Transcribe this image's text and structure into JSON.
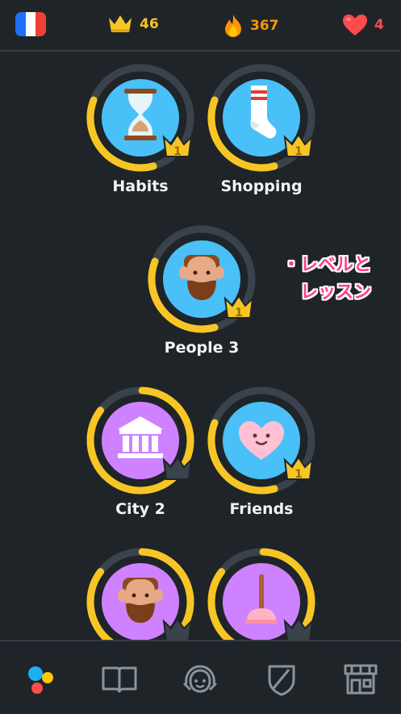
{
  "topbar": {
    "language_flag": "france-flag",
    "flag_colors": [
      "#1e6ff7",
      "#ffffff",
      "#ef4136"
    ],
    "crowns": "46",
    "streak": "367",
    "hearts": "4"
  },
  "skills": [
    {
      "name": "Habits",
      "icon": "hourglass-icon",
      "crown_level": "1",
      "progress": 0.35,
      "color": "#49c0f8"
    },
    {
      "name": "Shopping",
      "icon": "sock-icon",
      "crown_level": "1",
      "progress": 0.35,
      "color": "#49c0f8"
    },
    {
      "name": "People 3",
      "icon": "person-bearded-icon",
      "crown_level": "1",
      "progress": 0.35,
      "color": "#49c0f8"
    },
    {
      "name": "City 2",
      "icon": "building-icon",
      "crown_level": "",
      "progress": 0.9,
      "color": "#ce82ff"
    },
    {
      "name": "Friends",
      "icon": "heart-face-icon",
      "crown_level": "1",
      "progress": 0.35,
      "color": "#49c0f8"
    },
    {
      "name": "",
      "icon": "person-bearded-icon",
      "crown_level": "",
      "progress": 0.9,
      "color": "#ce82ff"
    },
    {
      "name": "",
      "icon": "plunger-icon",
      "crown_level": "",
      "progress": 0.9,
      "color": "#ce82ff"
    }
  ],
  "annotation": {
    "line1": "・レベルと",
    "line2": "レッスン"
  },
  "bottom_nav": [
    {
      "icon": "home-dots-icon",
      "active": true
    },
    {
      "icon": "book-icon",
      "active": false
    },
    {
      "icon": "profile-icon",
      "active": false
    },
    {
      "icon": "shield-icon",
      "active": false
    },
    {
      "icon": "shop-icon",
      "active": false
    }
  ]
}
